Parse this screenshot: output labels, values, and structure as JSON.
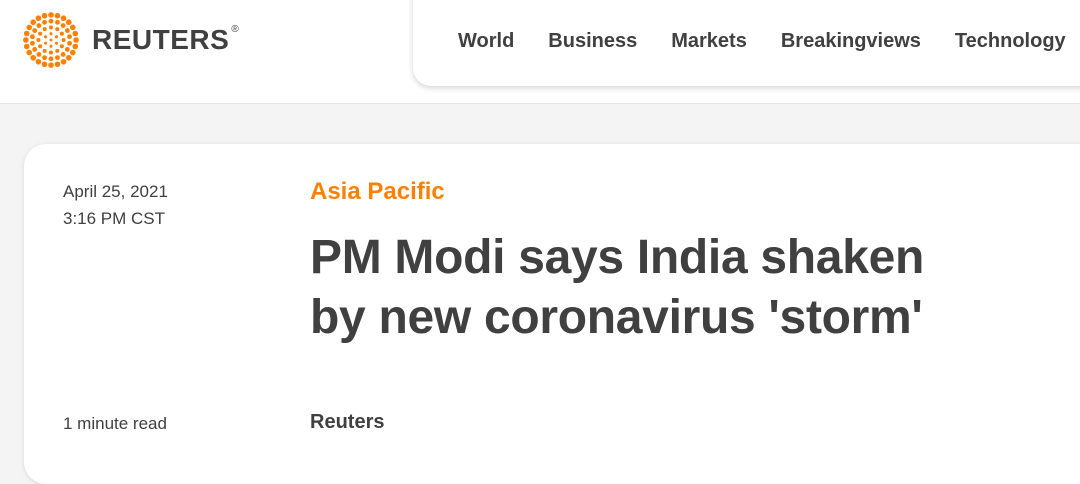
{
  "header": {
    "logo_text": "REUTERS",
    "logo_reg": "®",
    "brand_color": "#ff8000",
    "nav": [
      {
        "label": "World"
      },
      {
        "label": "Business"
      },
      {
        "label": "Markets"
      },
      {
        "label": "Breakingviews"
      },
      {
        "label": "Technology"
      }
    ]
  },
  "article": {
    "date": "April 25, 2021",
    "time": "3:16 PM CST",
    "section": "Asia Pacific",
    "headline_line1": "PM Modi says India shaken",
    "headline_line2": "by new coronavirus 'storm'",
    "read_time": "1 minute read",
    "byline": "Reuters"
  },
  "icons": {
    "logo": "reuters-dot-logo-icon"
  }
}
